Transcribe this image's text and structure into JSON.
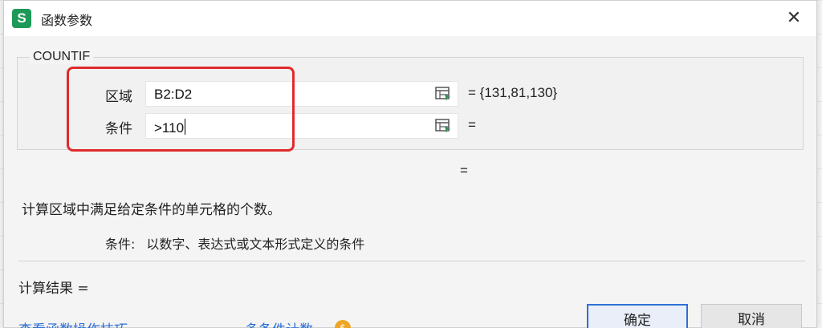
{
  "dialog": {
    "app_icon_letter": "S",
    "title": "函数参数",
    "close_glyph": "✕"
  },
  "function": {
    "name": "COUNTIF",
    "args": [
      {
        "label": "区域",
        "value": "B2:D2",
        "result": "= {131,81,130}"
      },
      {
        "label": "条件",
        "value": ">110",
        "result": "="
      }
    ],
    "formula_result": "="
  },
  "description": {
    "main": "计算区域中满足给定条件的单元格的个数。",
    "param_name": "条件:",
    "param_text": "以数字、表达式或文本形式定义的条件"
  },
  "result": {
    "label": "计算结果 ="
  },
  "links": {
    "tips": "查看函数操作技巧",
    "multi_count": "多条件计数"
  },
  "buttons": {
    "ok": "确定",
    "cancel": "取消"
  },
  "colors": {
    "highlight": "#e02b2b",
    "link": "#2a6fd8",
    "app_icon": "#1e9a58",
    "primary_border": "#2f6fd6"
  },
  "icons": {
    "app": "wps-sheet-icon",
    "ref": "range-select-icon",
    "badge": "coin-icon"
  }
}
